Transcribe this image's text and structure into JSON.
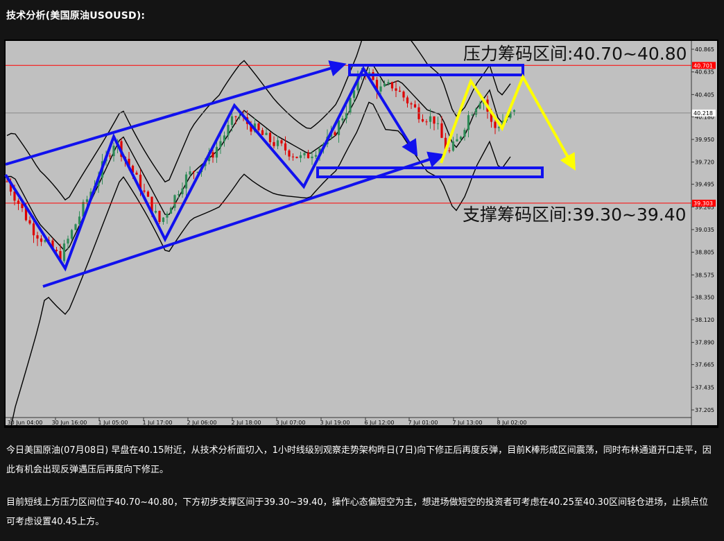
{
  "header": {
    "title": "技术分析(美国原油USOUSD):"
  },
  "chart_data": {
    "type": "candlestick",
    "title": "",
    "y_ticks": [
      40.865,
      40.635,
      40.405,
      40.18,
      39.95,
      39.72,
      39.495,
      39.265,
      39.035,
      38.805,
      38.575,
      38.35,
      38.12,
      37.89,
      37.665,
      37.435,
      37.205
    ],
    "ylim": [
      37.1,
      40.95
    ],
    "x_ticks": [
      "30 Jun 04:00",
      "30 Jun 16:00",
      "1 Jul 05:00",
      "1 Jul 17:00",
      "2 Jul 06:00",
      "2 Jul 18:00",
      "3 Jul 07:00",
      "3 Jul 19:00",
      "6 Jul 12:00",
      "7 Jul 01:00",
      "7 Jul 13:00",
      "8 Jul 02:00"
    ],
    "price_tags": {
      "resistance_line": "40.701",
      "current": "40.218",
      "support_line": "39.303"
    },
    "horizontal_lines": [
      {
        "value": 40.701,
        "color": "#ff0000"
      },
      {
        "value": 40.218,
        "color": "#888888"
      },
      {
        "value": 39.303,
        "color": "#ff0000"
      }
    ],
    "annotations": {
      "resistance": "压力筹码区间:40.70~40.80",
      "support": "支撑筹码区间:39.30~39.40"
    },
    "colors": {
      "up": "#2e8b57",
      "down": "#dd0000",
      "plot_bg": "#c0c0c0",
      "arrows_main": "#1111ee",
      "arrows_forecast": "#ffff00"
    },
    "grid": false
  },
  "text": {
    "paragraph1": "今日美国原油(07月08日) 早盘在40.15附近，从技术分析面切入，1小时线级别观察走势架构昨日(7日)向下修正后再度反弹，目前K棒形成区间震荡，同时布林通道开口走平，因此有机会出现反弹遇压后再度向下修正。",
    "paragraph2": "目前短线上方压力区间位于40.70~40.80，下方初步支撑区间于39.30~39.40，操作心态偏短空为主，想进场做短空的投资者可考虑在40.25至40.30区间轻仓进场，止损点位可考虑设置40.45上方。"
  }
}
